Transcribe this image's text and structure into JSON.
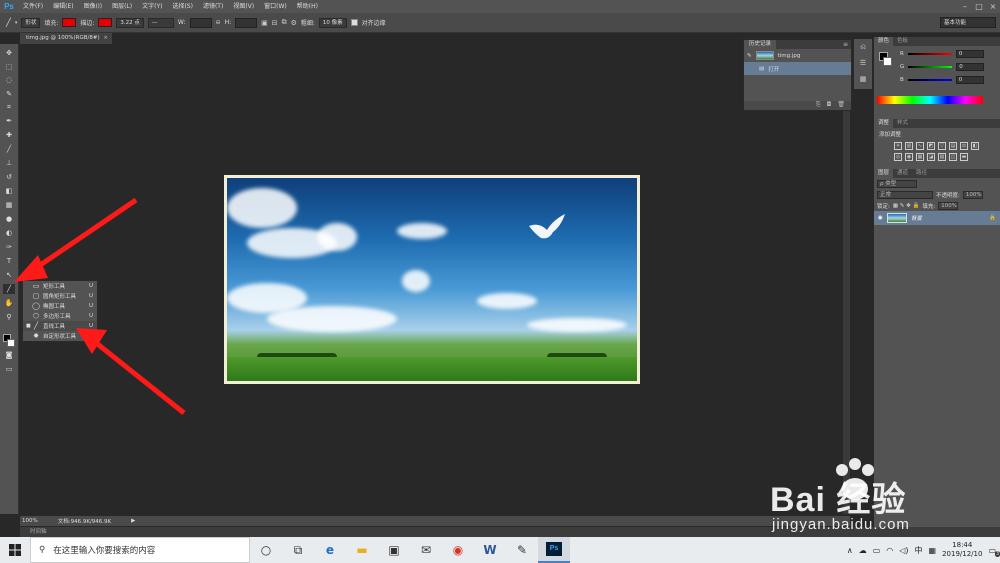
{
  "menu": [
    "文件(F)",
    "编辑(E)",
    "图像(I)",
    "图层(L)",
    "文字(Y)",
    "选择(S)",
    "滤镜(T)",
    "视图(V)",
    "窗口(W)",
    "帮助(H)"
  ],
  "app_logo": "Ps",
  "options": {
    "shape_mode": "形状",
    "fill_label": "填充:",
    "stroke_label": "描边:",
    "stroke_width": "3.22 点",
    "w_label": "W:",
    "h_label": "H:",
    "weight_label": "粗细:",
    "weight_value": "10 像素",
    "align_label": "对齐边缘",
    "workspace": "基本功能",
    "fill_color": "#e60000",
    "stroke_color": "#e60000"
  },
  "document_tab": {
    "title": "timg.jpg @ 100%(RGB/8#)",
    "close": "×"
  },
  "history": {
    "tabs": [
      "历史记录"
    ],
    "snapshot": "timg.jpg",
    "step": "打开"
  },
  "right_panels": {
    "color_tabs": [
      "颜色",
      "色板"
    ],
    "channels": [
      {
        "label": "R",
        "value": "0",
        "color": "#d33"
      },
      {
        "label": "G",
        "value": "0",
        "color": "#3c3"
      },
      {
        "label": "B",
        "value": "0",
        "color": "#33d"
      }
    ],
    "adj_tabs": [
      "调整",
      "样式"
    ],
    "adj_title": "添加调整",
    "layers_tabs": [
      "图层",
      "通道",
      "路径"
    ],
    "kind_label": "ρ 类型",
    "blend_mode": "正常",
    "opacity_label": "不透明度:",
    "opacity_value": "100%",
    "lock_label": "锁定:",
    "fill_label": "填充:",
    "fill_value": "100%",
    "layer_name": "背景"
  },
  "flyout": [
    {
      "label": "矩形工具",
      "key": "U",
      "icon": "▭",
      "selected": false
    },
    {
      "label": "圆角矩形工具",
      "key": "U",
      "icon": "▢",
      "selected": false
    },
    {
      "label": "椭圆工具",
      "key": "U",
      "icon": "◯",
      "selected": false
    },
    {
      "label": "多边形工具",
      "key": "U",
      "icon": "⬡",
      "selected": false
    },
    {
      "label": "直线工具",
      "key": "U",
      "icon": "╱",
      "selected": true
    },
    {
      "label": "自定形状工具",
      "key": "U",
      "icon": "✸",
      "selected": false
    }
  ],
  "status": {
    "zoom": "100%",
    "doc_size": "文档:946.9K/946.9K",
    "timeline": "时间轴"
  },
  "watermark": {
    "big": "Bai 经验",
    "small": "jingyan.baidu.com"
  },
  "taskbar": {
    "search_placeholder": "在这里输入你要搜索的内容",
    "ime": "中",
    "time": "18:44",
    "date": "2019/12/10",
    "notification_count": "3"
  }
}
